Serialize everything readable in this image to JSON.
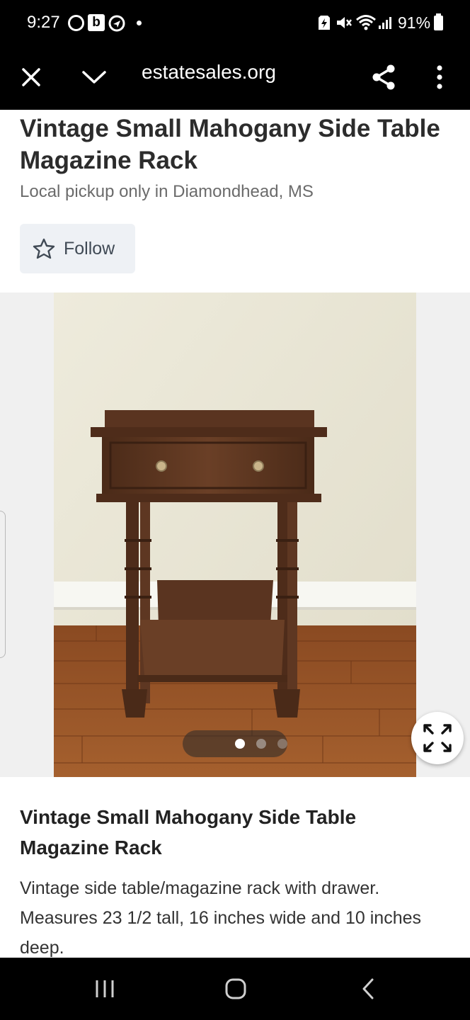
{
  "status_bar": {
    "time": "9:27",
    "b_badge": "b",
    "battery": "91%"
  },
  "browser": {
    "url": "estatesales.org",
    "icons": [
      "close-icon",
      "chevron-down-icon",
      "share-icon",
      "more-vertical-icon"
    ]
  },
  "listing": {
    "title": "Vintage Small Mahogany Side Table Magazine Rack",
    "pickup": "Local pickup only in Diamondhead, MS",
    "follow_label": "Follow",
    "gallery": {
      "photo_count": 3,
      "active_index": 0
    },
    "description_heading": "Vintage Small Mahogany Side Table Magazine Rack",
    "description_body": "Vintage side table/magazine rack with drawer. Measures 23 1/2 tall, 16 inches wide and 10 inches deep."
  },
  "nav_bar": {
    "icons": [
      "recent-apps-icon",
      "home-icon",
      "back-icon"
    ]
  },
  "colors": {
    "bar_background": "#000000",
    "follow_bg": "#eef1f5",
    "wood": "#5a3420",
    "floor": "#9a5a2c"
  }
}
